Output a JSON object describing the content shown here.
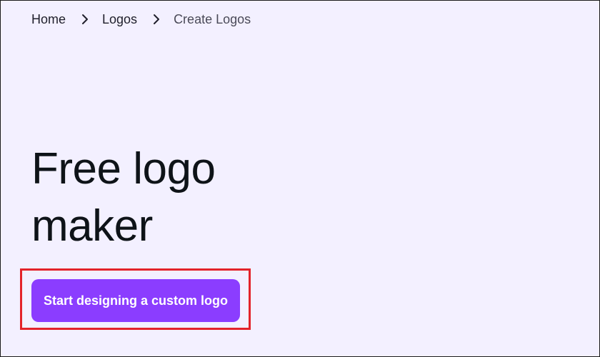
{
  "breadcrumb": {
    "items": [
      {
        "label": "Home"
      },
      {
        "label": "Logos"
      },
      {
        "label": "Create Logos"
      }
    ],
    "separator_icon": "chevron-right-icon"
  },
  "hero": {
    "title_line1": "Free logo",
    "title_line2": "maker"
  },
  "cta": {
    "label": "Start designing a custom logo"
  },
  "colors": {
    "background": "#f3f0ff",
    "cta_background": "#8b3dff",
    "cta_text": "#ffffff",
    "highlight_border": "#e3232a",
    "heading_text": "#0e1318"
  }
}
